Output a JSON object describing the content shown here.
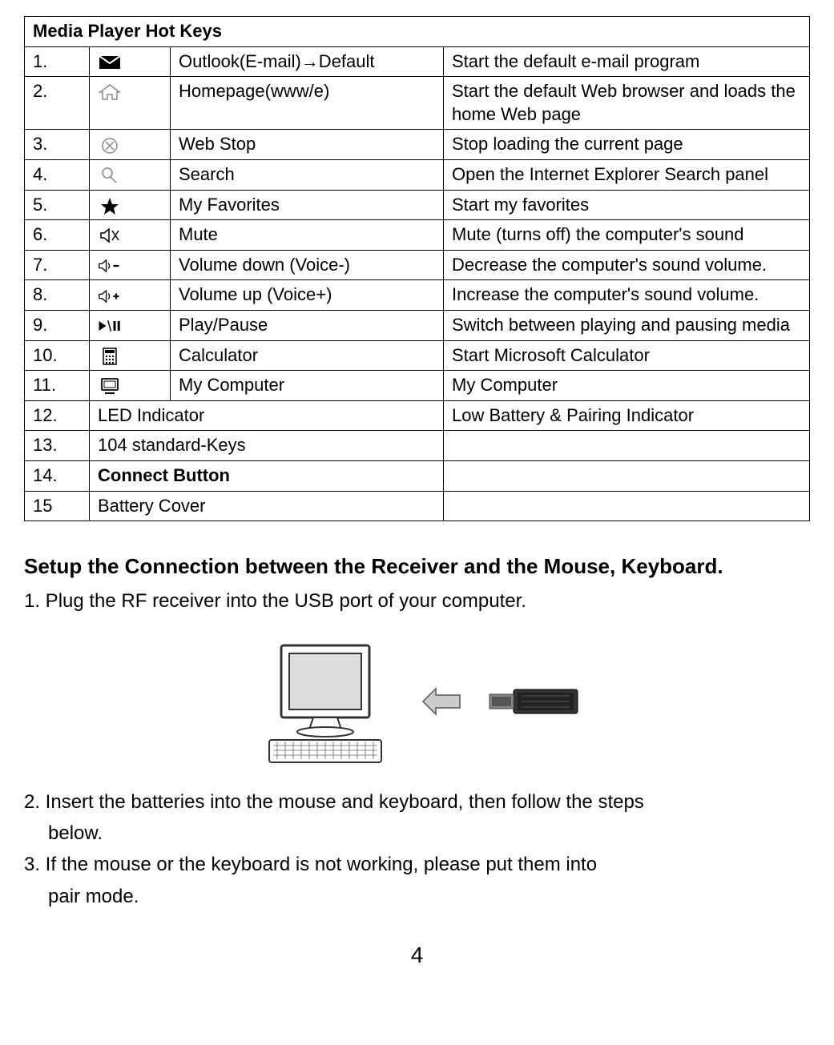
{
  "table": {
    "title": "Media Player Hot Keys",
    "rows": [
      {
        "num": "1.",
        "icon": "mail",
        "name": "Outlook(E-mail)→Default",
        "desc": "Start the default e-mail program"
      },
      {
        "num": "2.",
        "icon": "home",
        "name": "Homepage(www/e)",
        "desc": "Start the default Web browser and loads the home Web page"
      },
      {
        "num": "3.",
        "icon": "stop",
        "name": "Web Stop",
        "desc": "Stop loading the current page"
      },
      {
        "num": "4.",
        "icon": "search",
        "name": "Search",
        "desc": "Open the Internet Explorer Search panel"
      },
      {
        "num": "5.",
        "icon": "star",
        "name": "My Favorites",
        "desc": "Start my favorites"
      },
      {
        "num": "6.",
        "icon": "mute",
        "name": "Mute",
        "desc": "Mute (turns off) the computer's sound"
      },
      {
        "num": "7.",
        "icon": "voldown",
        "name": "Volume down (Voice-)",
        "desc": "Decrease the computer's sound volume."
      },
      {
        "num": "8.",
        "icon": "volup",
        "name": "Volume up (Voice+)",
        "desc": "Increase the computer's sound volume."
      },
      {
        "num": "9.",
        "icon": "playpause",
        "name": "Play/Pause",
        "desc": "Switch between playing and pausing media"
      },
      {
        "num": "10.",
        "icon": "calculator",
        "name": "Calculator",
        "desc": "Start Microsoft Calculator"
      },
      {
        "num": "11.",
        "icon": "computer",
        "name": "My Computer",
        "desc": "My Computer"
      }
    ],
    "merged_rows": [
      {
        "num": "12.",
        "name": "LED Indicator",
        "desc": "Low Battery & Pairing Indicator"
      },
      {
        "num": "13.",
        "name": "104 standard-Keys",
        "desc": ""
      },
      {
        "num": "14.",
        "name": "Connect Button",
        "desc": "",
        "bold": true
      },
      {
        "num": "15",
        "name": "Battery Cover",
        "desc": ""
      }
    ]
  },
  "section": {
    "heading": "Setup the Connection between the Receiver and the Mouse, Keyboard.",
    "step1": "1. Plug the RF receiver into the USB port of your computer.",
    "step2": "2. Insert the batteries into the mouse and keyboard, then follow the steps",
    "step2b": "below.",
    "step3": "3. If the mouse or the keyboard is not working, please put them into",
    "step3b": "pair mode."
  },
  "page_number": "4"
}
